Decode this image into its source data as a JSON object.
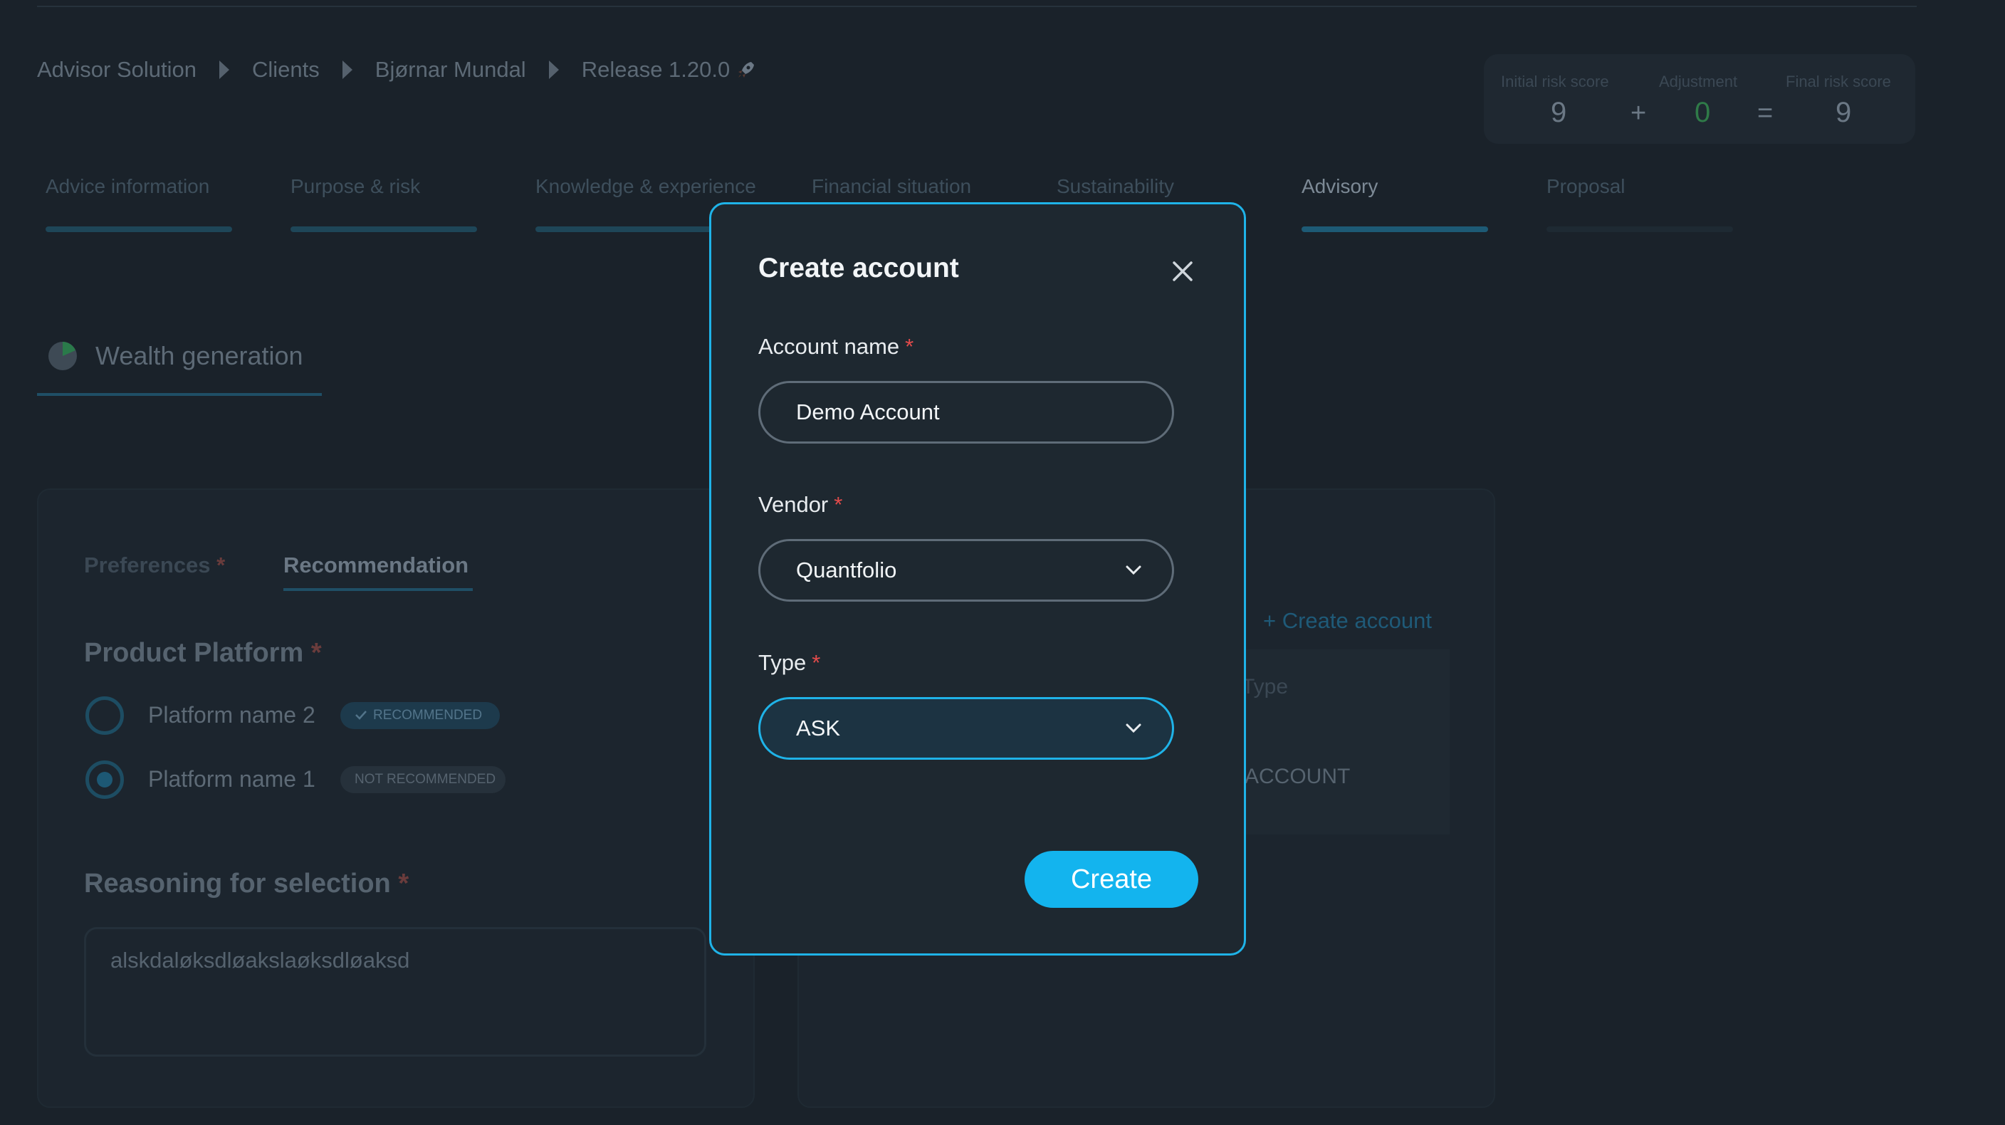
{
  "breadcrumb": [
    "Advisor Solution",
    "Clients",
    "Bjørnar Mundal",
    "Release 1.20.0"
  ],
  "risk": {
    "initial_label": "Initial risk score",
    "initial_value": "9",
    "adjustment_label": "Adjustment",
    "adjustment_value": "0",
    "final_label": "Final risk score",
    "final_value": "9",
    "plus": "+",
    "equals": "="
  },
  "tabs": [
    {
      "label": "Advice information"
    },
    {
      "label": "Purpose & risk"
    },
    {
      "label": "Knowledge & experience"
    },
    {
      "label": "Financial situation"
    },
    {
      "label": "Sustainability"
    },
    {
      "label": "Advisory",
      "active": true
    },
    {
      "label": "Proposal"
    }
  ],
  "goal": {
    "title": "Wealth generation",
    "icon": "pie-chart-icon"
  },
  "subtabs": {
    "preferences": "Preferences",
    "recommendation": "Recommendation",
    "asterisk": "*"
  },
  "product_platform": {
    "title": "Product Platform",
    "options": [
      {
        "label": "Platform name 2",
        "badge": "RECOMMENDED",
        "checked": false
      },
      {
        "label": "Platform name 1",
        "badge": "NOT RECOMMENDED",
        "checked": true
      }
    ]
  },
  "reasoning": {
    "title": "Reasoning for selection",
    "value": "alskdaløksdløakslaøksdløaksd"
  },
  "accounts": {
    "create_link": "+ Create account",
    "col_type": "Type",
    "row_value": "ACCOUNT"
  },
  "modal": {
    "title": "Create account",
    "account_name_label": "Account name",
    "account_name_value": "Demo Account",
    "vendor_label": "Vendor",
    "vendor_value": "Quantfolio",
    "type_label": "Type",
    "type_value": "ASK",
    "required_mark": "*",
    "create_button": "Create"
  },
  "colors": {
    "accent": "#13b4ee",
    "required": "#e24b4b",
    "background": "#1a222a"
  }
}
